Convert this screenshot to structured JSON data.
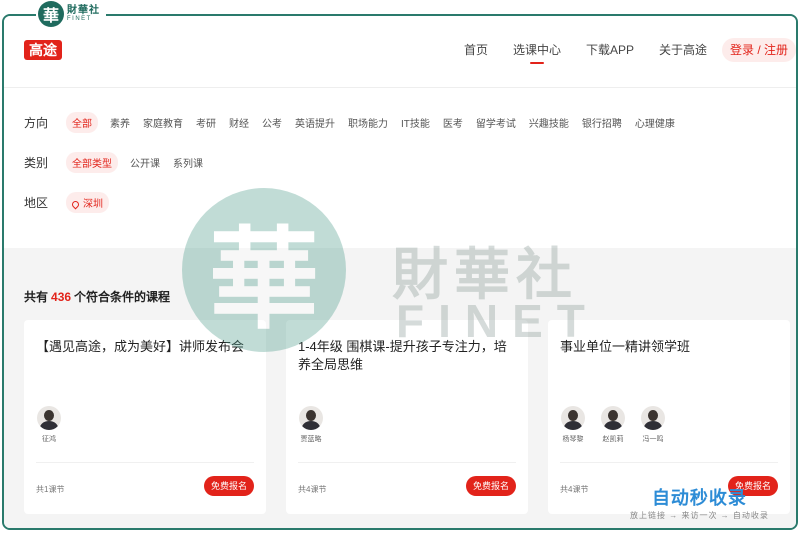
{
  "finet": {
    "cn": "財華社",
    "en": "FINET"
  },
  "header": {
    "logo": "高途",
    "nav": [
      {
        "label": "首页"
      },
      {
        "label": "选课中心"
      },
      {
        "label": "下载APP"
      },
      {
        "label": "关于高途"
      }
    ],
    "login": "登录 / 注册"
  },
  "filters": {
    "direction": {
      "label": "方向",
      "options": [
        "全部",
        "素养",
        "家庭教育",
        "考研",
        "财经",
        "公考",
        "英语提升",
        "职场能力",
        "IT技能",
        "医考",
        "留学考试",
        "兴趣技能",
        "银行招聘",
        "心理健康"
      ]
    },
    "category": {
      "label": "类别",
      "options": [
        "全部类型",
        "公开课",
        "系列课"
      ]
    },
    "region": {
      "label": "地区",
      "value": "深圳"
    }
  },
  "results": {
    "prefix": "共有",
    "count": "436",
    "suffix": "个符合条件的课程"
  },
  "cards": [
    {
      "title": "【遇见高途，成为美好】讲师发布会",
      "teachers": [
        "征鸿"
      ],
      "lessons": "共1课节",
      "button": "免费报名"
    },
    {
      "title": "1-4年级 围棋课-提升孩子专注力，培养全局思维",
      "teachers": [
        "贾蓝略"
      ],
      "lessons": "共4课节",
      "button": "免费报名"
    },
    {
      "title": "事业单位一精讲领学班",
      "teachers": [
        "杨琴黎",
        "赵凯莉",
        "冯一鸣"
      ],
      "lessons": "共4课节",
      "button": "免费报名"
    }
  ],
  "watermark": {
    "seal": "華",
    "cn": "財華社",
    "en": "FINET"
  },
  "stamp": {
    "main": "自动秒收录",
    "sub": "放上链接 → 来访一次 → 自动收录"
  }
}
